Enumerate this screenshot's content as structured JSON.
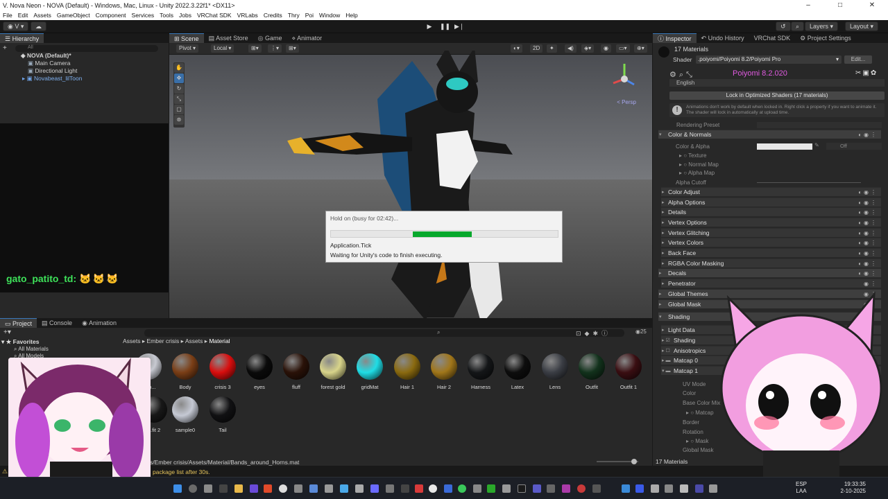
{
  "window": {
    "title": "V. Nova Neon - NOVA (Default) - Windows, Mac, Linux - Unity 2022.3.22f1* <DX11>",
    "controls": [
      "–",
      "□",
      "✕"
    ]
  },
  "menu": [
    "File",
    "Edit",
    "Assets",
    "GameObject",
    "Component",
    "Services",
    "Tools",
    "Jobs",
    "VRChat SDK",
    "VRLabs",
    "Credits",
    "Thry",
    "Poi",
    "Window",
    "Help"
  ],
  "toolbar": {
    "account": "V",
    "layers": "Layers",
    "layout": "Layout"
  },
  "hierarchy": {
    "tab": "Hierarchy",
    "search_placeholder": "All",
    "scene": "NOVA (Default)*",
    "items": [
      "Main Camera",
      "Directional Light",
      "Novabeast_lilToon"
    ]
  },
  "chat": {
    "user": "gato_patito_td:",
    "emotes": "🐱🐱🐱"
  },
  "scene_tabs": [
    "Scene",
    "Asset Store",
    "Game",
    "Animator"
  ],
  "scene_tools": {
    "pivot": "Pivot",
    "local": "Local",
    "mode_2d": "2D",
    "persp": "< Persp"
  },
  "dialog": {
    "title": "Hold on (busy for 02:42)...",
    "progress": 0.26,
    "progress_start": 0.36,
    "line1": "Application.Tick",
    "line2": "Waiting for Unity's code to finish executing."
  },
  "inspector": {
    "tabs": [
      "Inspector",
      "Undo History",
      "VRChat SDK",
      "Project Settings"
    ],
    "count": "17 Materials",
    "shader_label": "Shader",
    "shader_value": ".poiyomi/Poiyomi 8.2/Poiyomi Pro",
    "edit": "Edit...",
    "version": "Poiyomi 8.2.020",
    "language": "English",
    "lock_button": "Lock in Optimized Shaders (17 materials)",
    "warning": "Animations don't work by default when locked in. Right click a property if you want to animate it. The shader will lock in automatically at upload time.",
    "rendering_preset": "Rendering Preset",
    "color_normals": "Color & Normals",
    "color_alpha": "Color & Alpha",
    "off": "Off",
    "texture": "Texture",
    "normal_map": "Normal Map",
    "alpha_map": "Alpha Map",
    "alpha_cutoff": "Alpha Cutoff",
    "sections": [
      "Color Adjust",
      "Alpha Options",
      "Details",
      "Vertex Options",
      "Vertex Glitching",
      "Vertex Colors",
      "Back Face",
      "RGBA Color Masking",
      "Decals",
      "Penetrator",
      "Global Themes",
      "Global Mask"
    ],
    "shading": "Shading",
    "shading_items": [
      "Light Data",
      "Shading",
      "Anisotropics",
      "Matcap 0",
      "Matcap 1"
    ],
    "matcap_props": [
      "UV Mode",
      "Color",
      "Base Color Mix",
      "Matcap",
      "Border",
      "Rotation",
      "Mask",
      "Global Mask"
    ],
    "footer": "17 Materials"
  },
  "project": {
    "tabs": [
      "Project",
      "Console",
      "Animation"
    ],
    "favorites": "Favorites",
    "fav_items": [
      "All Materials",
      "All Models"
    ],
    "breadcrumb": [
      "Assets",
      "Ember crisis",
      "Assets",
      "Material"
    ],
    "materials": [
      {
        "label": "_aro...",
        "color": "#c7c9d1"
      },
      {
        "label": "Body",
        "color": "#7a3e16"
      },
      {
        "label": "crisis 3",
        "color": "#d90e0e"
      },
      {
        "label": "eyes",
        "color": "#0a0a0a"
      },
      {
        "label": "fluff",
        "color": "#2a1208"
      },
      {
        "label": "forest gold",
        "color": "#d8d48a"
      },
      {
        "label": "gridMat",
        "color": "#1fdde6"
      },
      {
        "label": "Hair 1",
        "color": "#8a6a10"
      },
      {
        "label": "Hair 2",
        "color": "#a0761a"
      },
      {
        "label": "Harness",
        "color": "#141618"
      },
      {
        "label": "Latex",
        "color": "#0d0d0d"
      },
      {
        "label": "Lens",
        "color": "#3a3d44"
      },
      {
        "label": "Outfit",
        "color": "#12321c"
      },
      {
        "label": "Outfit 1",
        "color": "#3a0e12"
      },
      {
        "label": "...fit 2",
        "color": "#181818"
      },
      {
        "label": "sample0",
        "color": "#c5c9d4"
      },
      {
        "label": "Tail",
        "color": "#111113"
      }
    ],
    "path": "s/Ember crisis/Assets/Material/Bands_around_Horns.mat",
    "zoom_badge": "25",
    "status": "package list after 30s."
  },
  "taskbar": {
    "lang1": "ESP",
    "lang2": "LAA",
    "time": "19:33:35",
    "date": "2-10-2025"
  }
}
